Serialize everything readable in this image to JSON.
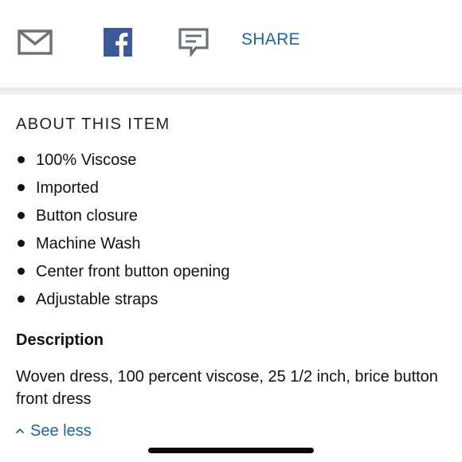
{
  "share_bar": {
    "icons": [
      "envelope-icon",
      "facebook-icon",
      "comment-icon"
    ],
    "share_label": "SHARE",
    "colors": {
      "icon_gray": "#6b7378",
      "facebook_blue": "#3b5a98",
      "link_blue": "#1f63a6"
    }
  },
  "about": {
    "title": "ABOUT THIS ITEM",
    "bullets": [
      "100% Viscose",
      "Imported",
      "Button closure",
      "Machine Wash",
      "Center front button opening",
      "Adjustable straps"
    ]
  },
  "description": {
    "heading": "Description",
    "text": "Woven dress, 100 percent viscose, 25 1/2 inch, brice button front dress"
  },
  "toggle": {
    "label": "See less",
    "icon": "chevron-up-icon"
  }
}
